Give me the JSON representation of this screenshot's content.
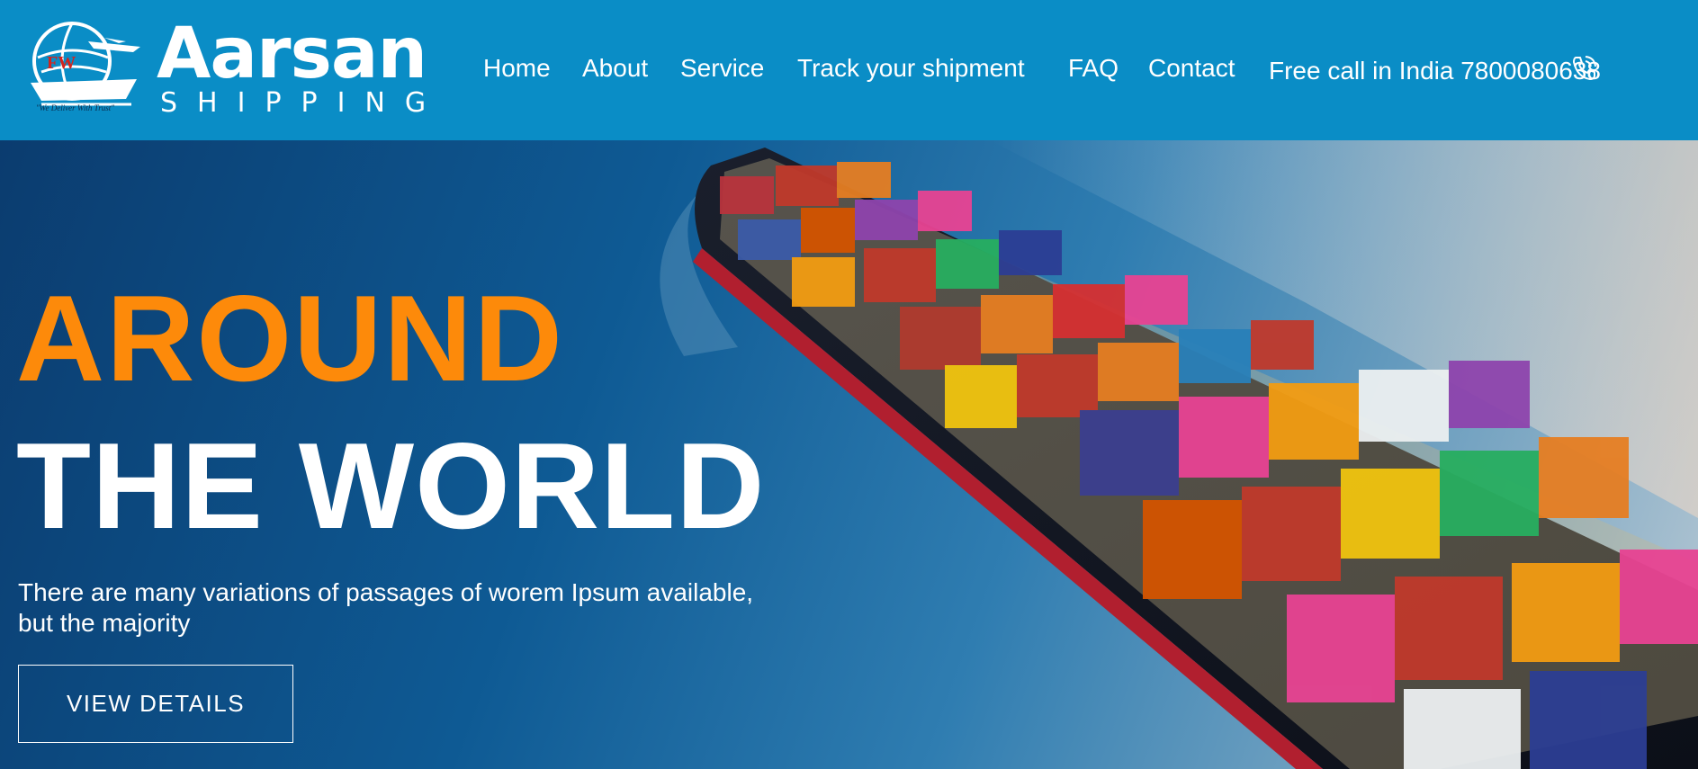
{
  "brand": {
    "name": "Aarsan",
    "sub": "SHIPPING",
    "tagline": "\"We Deliver With Trust\"",
    "logo_icon": "ship-globe-logo-icon",
    "emblem_mark": "FW"
  },
  "nav": {
    "items": [
      {
        "label": "Home"
      },
      {
        "label": "About"
      },
      {
        "label": "Service"
      },
      {
        "label": "Track your shipment"
      },
      {
        "label": "FAQ"
      },
      {
        "label": "Contact"
      }
    ],
    "call_text": "Free call in India 7800080638",
    "call_icon": "phone-icon"
  },
  "hero": {
    "title_line1": "AROUND",
    "title_line2": "THE WORLD",
    "text_line1": "There are many variations of passages of worem Ipsum available,",
    "text_line2": "but the majority",
    "button_label": "VIEW DETAILS",
    "background": "container-ship-photo"
  },
  "colors": {
    "header_bg": "#0a8dc6",
    "accent_orange": "#fd8a0a",
    "text_white": "#ffffff",
    "sea_dark": "#0b3c6f"
  }
}
